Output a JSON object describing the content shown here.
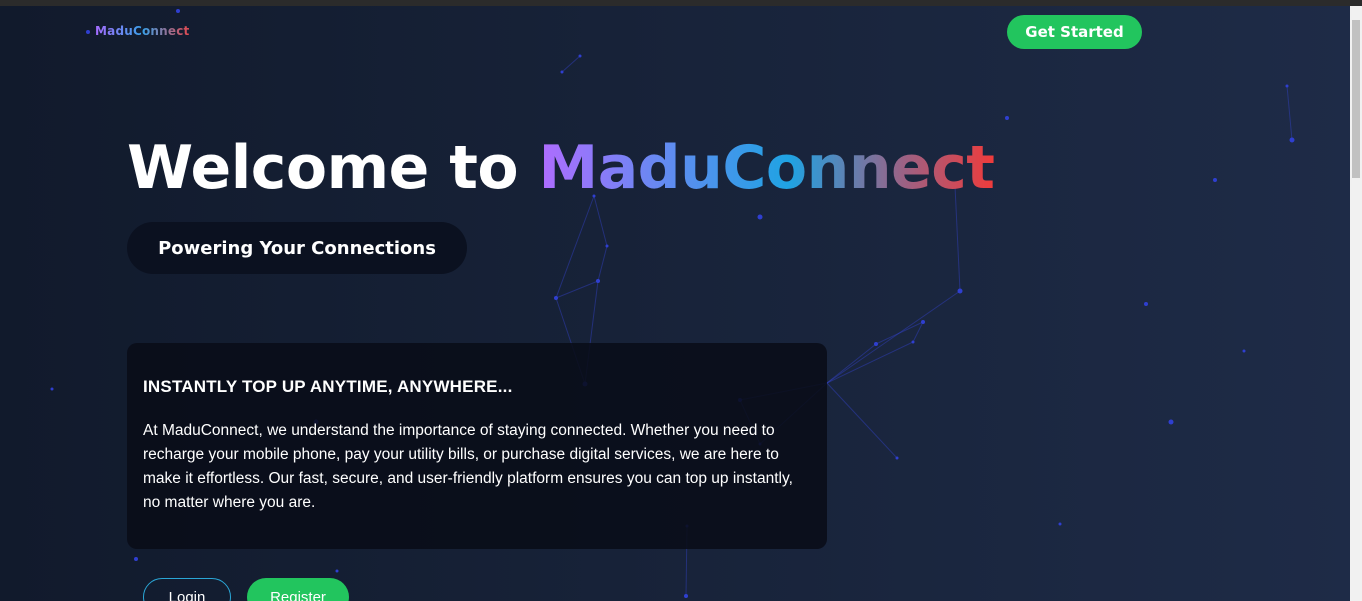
{
  "header": {
    "logo_text": "MaduConnect",
    "cta_label": "Get Started"
  },
  "hero": {
    "title_prefix": "Welcome to ",
    "title_brand": "MaduConnect",
    "tagline": "Powering Your Connections"
  },
  "info_card": {
    "heading": "INSTANTLY TOP UP ANYTIME, ANYWHERE...",
    "body": "At MaduConnect, we understand the importance of staying connected. Whether you need to recharge your mobile phone, pay your utility bills, or purchase digital services, we are here to make it effortless. Our fast, secure, and user-friendly platform ensures you can top up instantly, no matter where you are."
  },
  "actions": {
    "login_label": "Login",
    "register_label": "Register"
  },
  "colors": {
    "accent_green": "#22c55e",
    "login_border": "#2aa6d6",
    "background_dark": "#111a2c",
    "background_light": "#1e2b47",
    "particle_color": "#2f3fd0"
  }
}
